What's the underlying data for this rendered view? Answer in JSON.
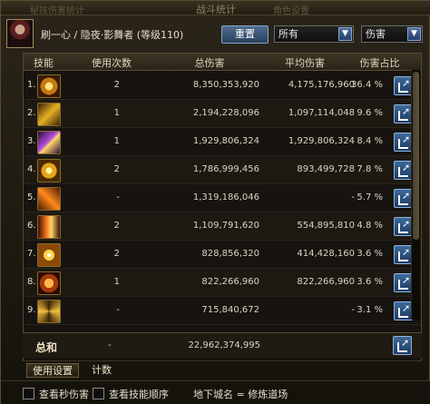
{
  "window": {
    "title": "战斗统计",
    "ghost_left": "秘技伤害统计",
    "ghost_right": "角色设置"
  },
  "header": {
    "character_name": "刷一心 / 隐夜·影舞者 (等级110)",
    "reset_label": "重置",
    "filter_target": "所有",
    "filter_metric": "伤害"
  },
  "table": {
    "columns": [
      "技能",
      "使用次数",
      "总伤害",
      "平均伤害",
      "伤害占比"
    ],
    "rows": [
      {
        "index": "1.",
        "icon": "gold-burst-skill-icon",
        "uses": "2",
        "total": "8,350,353,920",
        "avg": "4,175,176,960",
        "share": "36.4 %"
      },
      {
        "index": "2.",
        "icon": "gold-slash-skill-icon",
        "uses": "1",
        "total": "2,194,228,096",
        "avg": "1,097,114,048",
        "share": "9.6 %"
      },
      {
        "index": "3.",
        "icon": "purple-strike-skill-icon",
        "uses": "1",
        "total": "1,929,806,324",
        "avg": "1,929,806,324",
        "share": "8.4 %"
      },
      {
        "index": "4.",
        "icon": "yellow-spin-skill-icon",
        "uses": "2",
        "total": "1,786,999,456",
        "avg": "893,499,728",
        "share": "7.8 %"
      },
      {
        "index": "5.",
        "icon": "orange-blade-skill-icon",
        "uses": "-",
        "total": "1,319,186,046",
        "avg": "-",
        "share": "5.7 %"
      },
      {
        "index": "6.",
        "icon": "fire-lance-skill-icon",
        "uses": "2",
        "total": "1,109,791,620",
        "avg": "554,895,810",
        "share": "4.8 %"
      },
      {
        "index": "7.",
        "icon": "star-flash-skill-icon",
        "uses": "2",
        "total": "828,856,320",
        "avg": "414,428,160",
        "share": "3.6 %"
      },
      {
        "index": "8.",
        "icon": "fire-sigil-skill-icon",
        "uses": "1",
        "total": "822,266,960",
        "avg": "822,266,960",
        "share": "3.6 %"
      },
      {
        "index": "9.",
        "icon": "gold-spiral-skill-icon",
        "uses": "-",
        "total": "715,840,672",
        "avg": "-",
        "share": "3.1 %"
      }
    ]
  },
  "total": {
    "label": "总和",
    "uses": "-",
    "total": "22,962,374,995"
  },
  "tabs": [
    "使用设置",
    "计数"
  ],
  "footer": {
    "check_dps_label": "查看秒伤害",
    "check_order_label": "查看技能顺序",
    "location": "地下城名 = 修炼道场"
  }
}
